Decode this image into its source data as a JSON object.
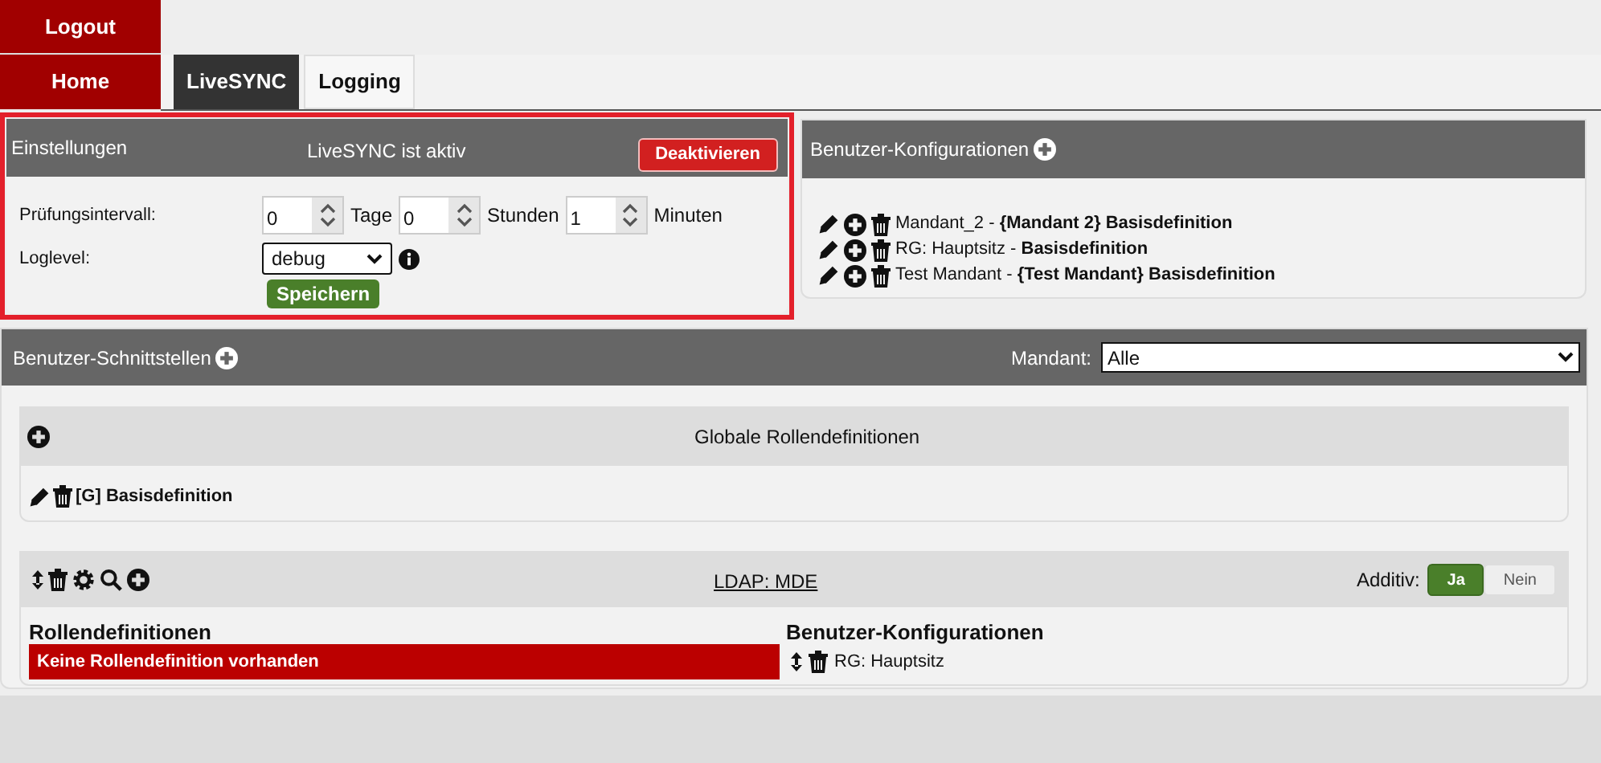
{
  "top_nav": [
    {
      "label": "Logout"
    },
    {
      "label": "Home"
    }
  ],
  "tabs": [
    {
      "label": "LiveSYNC",
      "selected": true
    },
    {
      "label": "Logging",
      "selected": false
    }
  ],
  "settings": {
    "title": "Einstellungen",
    "status": "LiveSYNC ist aktiv",
    "deactivate_button": "Deaktivieren",
    "interval_label": "Prüfungsintervall:",
    "interval": [
      {
        "value": "0",
        "unit": "Tage"
      },
      {
        "value": "0",
        "unit": "Stunden"
      },
      {
        "value": "1",
        "unit": "Minuten"
      }
    ],
    "loglevel_label": "Loglevel:",
    "loglevel": "debug",
    "save_button": "Speichern"
  },
  "user_configs": {
    "title": "Benutzer-Konfigurationen",
    "items": [
      {
        "text": "Mandant_2 - **{Mandant 2} Basisdefinition**"
      },
      {
        "text": "RG: Hauptsitz - **Basisdefinition**"
      },
      {
        "text": "Test Mandant - **{Test Mandant} Basisdefinition**"
      }
    ]
  },
  "interfaces": {
    "title": "Benutzer-Schnittstellen",
    "mandant_label": "Mandant:",
    "mandant": "Alle",
    "global_roles": {
      "title": "Globale Rollendefinitionen",
      "items": [
        "[G] Basisdefinition"
      ]
    },
    "ldap": {
      "title": "LDAP: MDE",
      "additive_label": "Additiv:",
      "options": [
        {
          "label": "Ja",
          "selected": true
        },
        {
          "label": "Nein",
          "selected": false
        }
      ],
      "roles_title": "Rollendefinitionen",
      "roles_empty": "Keine Rollendefinition vorhanden",
      "configs_title": "Benutzer-Konfigurationen",
      "configs": [
        "RG: Hauptsitz"
      ]
    }
  }
}
